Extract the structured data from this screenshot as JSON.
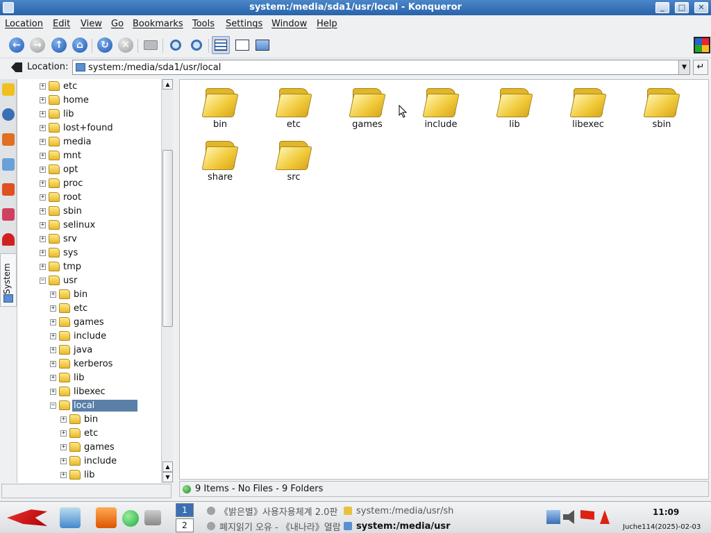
{
  "window": {
    "title": "system:/media/sda1/usr/local - Konqueror"
  },
  "menu": [
    "Location",
    "Edit",
    "View",
    "Go",
    "Bookmarks",
    "Tools",
    "Settings",
    "Window",
    "Help"
  ],
  "location": {
    "label": "Location:",
    "value": "system:/media/sda1/usr/local"
  },
  "sidebar": {
    "system_tab_label": "System"
  },
  "tree": [
    {
      "label": "etc",
      "level": 0,
      "expanded": false
    },
    {
      "label": "home",
      "level": 0,
      "expanded": false
    },
    {
      "label": "lib",
      "level": 0,
      "expanded": false
    },
    {
      "label": "lost+found",
      "level": 0,
      "expanded": false
    },
    {
      "label": "media",
      "level": 0,
      "expanded": false
    },
    {
      "label": "mnt",
      "level": 0,
      "expanded": false
    },
    {
      "label": "opt",
      "level": 0,
      "expanded": false
    },
    {
      "label": "proc",
      "level": 0,
      "expanded": false
    },
    {
      "label": "root",
      "level": 0,
      "expanded": false
    },
    {
      "label": "sbin",
      "level": 0,
      "expanded": false
    },
    {
      "label": "selinux",
      "level": 0,
      "expanded": false
    },
    {
      "label": "srv",
      "level": 0,
      "expanded": false
    },
    {
      "label": "sys",
      "level": 0,
      "expanded": false
    },
    {
      "label": "tmp",
      "level": 0,
      "expanded": false
    },
    {
      "label": "usr",
      "level": 0,
      "expanded": true
    },
    {
      "label": "bin",
      "level": 1,
      "expanded": false
    },
    {
      "label": "etc",
      "level": 1,
      "expanded": false
    },
    {
      "label": "games",
      "level": 1,
      "expanded": false
    },
    {
      "label": "include",
      "level": 1,
      "expanded": false
    },
    {
      "label": "java",
      "level": 1,
      "expanded": false
    },
    {
      "label": "kerberos",
      "level": 1,
      "expanded": false
    },
    {
      "label": "lib",
      "level": 1,
      "expanded": false
    },
    {
      "label": "libexec",
      "level": 1,
      "expanded": false
    },
    {
      "label": "local",
      "level": 1,
      "expanded": true,
      "selected": true
    },
    {
      "label": "bin",
      "level": 2,
      "expanded": false
    },
    {
      "label": "etc",
      "level": 2,
      "expanded": false
    },
    {
      "label": "games",
      "level": 2,
      "expanded": false
    },
    {
      "label": "include",
      "level": 2,
      "expanded": false
    },
    {
      "label": "lib",
      "level": 2,
      "expanded": false
    }
  ],
  "folders": [
    "bin",
    "etc",
    "games",
    "include",
    "lib",
    "libexec",
    "sbin",
    "share",
    "src"
  ],
  "status": {
    "text": "9 Items - No Files - 9 Folders"
  },
  "taskbar": {
    "pager": [
      "1",
      "2"
    ],
    "tasks": [
      {
        "label": "《밝은별》사용자용체계 2.0판",
        "active": false
      },
      {
        "label": "system:/media/usr/sh",
        "active": false
      },
      {
        "label": "폐지읽기 오유 - 《내나라》열람",
        "active": false
      },
      {
        "label": "system:/media/usr",
        "active": true
      }
    ],
    "clock": "11:09",
    "date": "Juche114(2025)-02-03"
  }
}
